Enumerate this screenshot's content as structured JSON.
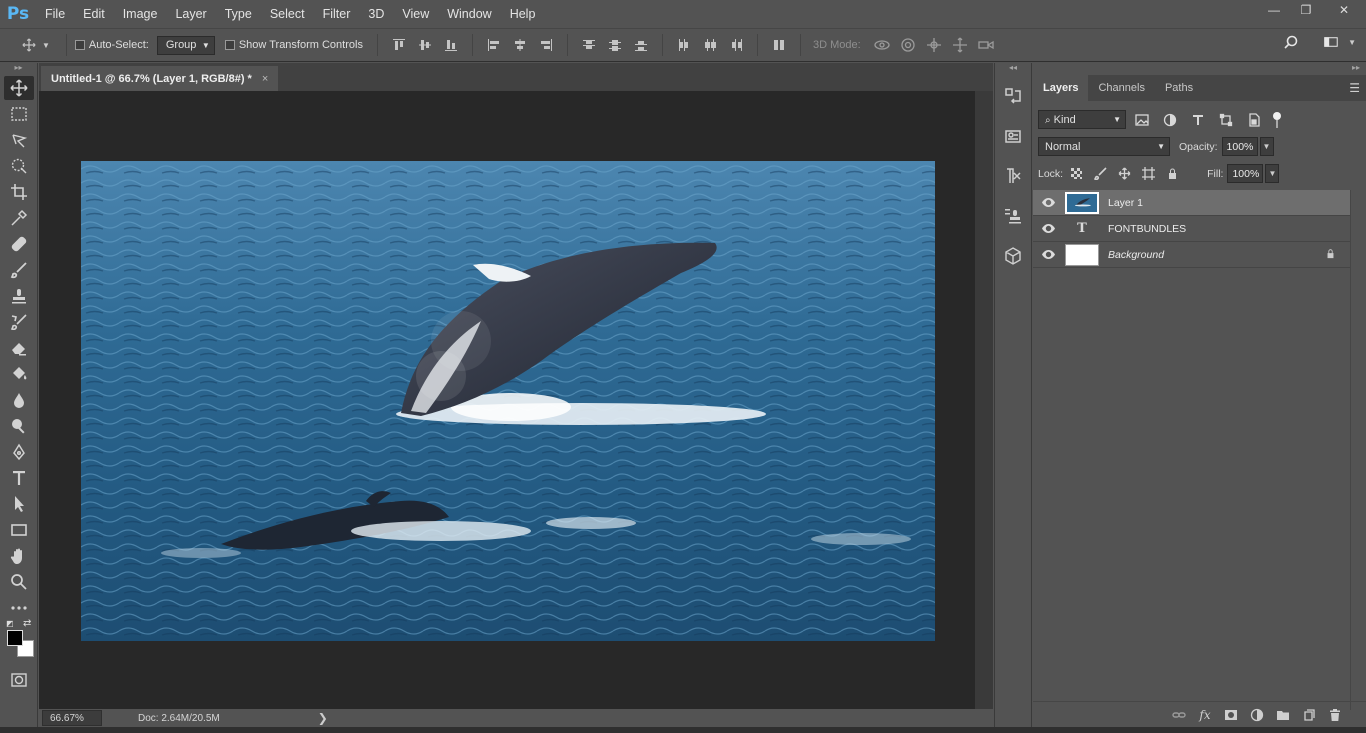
{
  "app": {
    "logo": "Ps"
  },
  "menu": [
    "File",
    "Edit",
    "Image",
    "Layer",
    "Type",
    "Select",
    "Filter",
    "3D",
    "View",
    "Window",
    "Help"
  ],
  "window_controls": {
    "minimize": "—",
    "restore": "❐",
    "close": "✕"
  },
  "options": {
    "auto_select_label": "Auto-Select:",
    "auto_select_value": "Group",
    "show_transform_label": "Show Transform Controls",
    "mode_3d_label": "3D Mode:"
  },
  "document": {
    "tab_title": "Untitled-1 @ 66.7% (Layer 1, RGB/8#) *",
    "tab_close": "×",
    "zoom": "66.67%",
    "doc_size": "Doc: 2.64M/20.5M",
    "status_arrow": "❯"
  },
  "panel": {
    "tabs": [
      "Layers",
      "Channels",
      "Paths"
    ],
    "active_tab": "Layers",
    "filter_kind": "Kind",
    "blend_mode": "Normal",
    "opacity_label": "Opacity:",
    "opacity_value": "100%",
    "lock_label": "Lock:",
    "fill_label": "Fill:",
    "fill_value": "100%"
  },
  "layers": [
    {
      "name": "Layer 1",
      "type": "image",
      "selected": true,
      "visible": true
    },
    {
      "name": "FONTBUNDLES",
      "type": "text",
      "selected": false,
      "visible": true
    },
    {
      "name": "Background",
      "type": "background",
      "selected": false,
      "visible": true,
      "locked": true
    }
  ],
  "footer_icons": [
    "link-icon",
    "fx-icon",
    "mask-icon",
    "adjustment-icon",
    "group-folder-icon",
    "new-layer-icon",
    "trash-icon"
  ],
  "colors": {
    "foreground": "#000000",
    "background": "#ffffff",
    "accent": "#5ab8f5"
  }
}
